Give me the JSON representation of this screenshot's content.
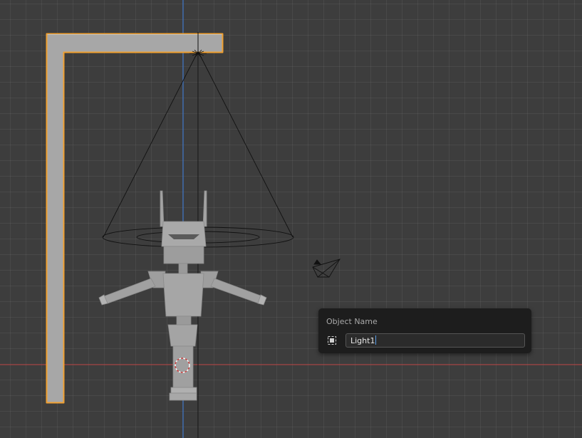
{
  "viewport": {
    "background": "#3d3d3d",
    "grid_color": "#474747",
    "x_axis_color": "#c23b3b",
    "z_axis_color": "#3c6bb0",
    "selection_outline_color": "#f0a030"
  },
  "scene": {
    "objects": [
      {
        "name": "gallows-frame",
        "selected": true
      },
      {
        "name": "robot-figure",
        "selected": false
      },
      {
        "name": "spot-light",
        "selected": false
      },
      {
        "name": "camera",
        "selected": false
      },
      {
        "name": "3d-cursor",
        "selected": false
      }
    ]
  },
  "rename_popup": {
    "title": "Object Name",
    "value": "Light1",
    "icon": "object-data-icon"
  }
}
